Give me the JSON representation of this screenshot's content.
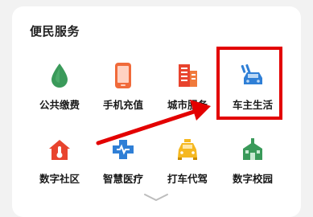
{
  "section": {
    "title": "便民服务"
  },
  "services": [
    {
      "label": "公共缴费",
      "icon": "water-drop-icon"
    },
    {
      "label": "手机充值",
      "icon": "phone-icon"
    },
    {
      "label": "城市服务",
      "icon": "building-icon"
    },
    {
      "label": "车主生活",
      "icon": "car-icon"
    },
    {
      "label": "数字社区",
      "icon": "home-thermometer-icon"
    },
    {
      "label": "智慧医疗",
      "icon": "medical-cross-icon"
    },
    {
      "label": "打车代驾",
      "icon": "taxi-icon"
    },
    {
      "label": "数字校园",
      "icon": "school-icon"
    }
  ],
  "colors": {
    "accent_red": "#e30000",
    "green": "#3a9a5a",
    "orange": "#f06a3a",
    "blue": "#2f7fd6",
    "yellow": "#f5b820"
  }
}
